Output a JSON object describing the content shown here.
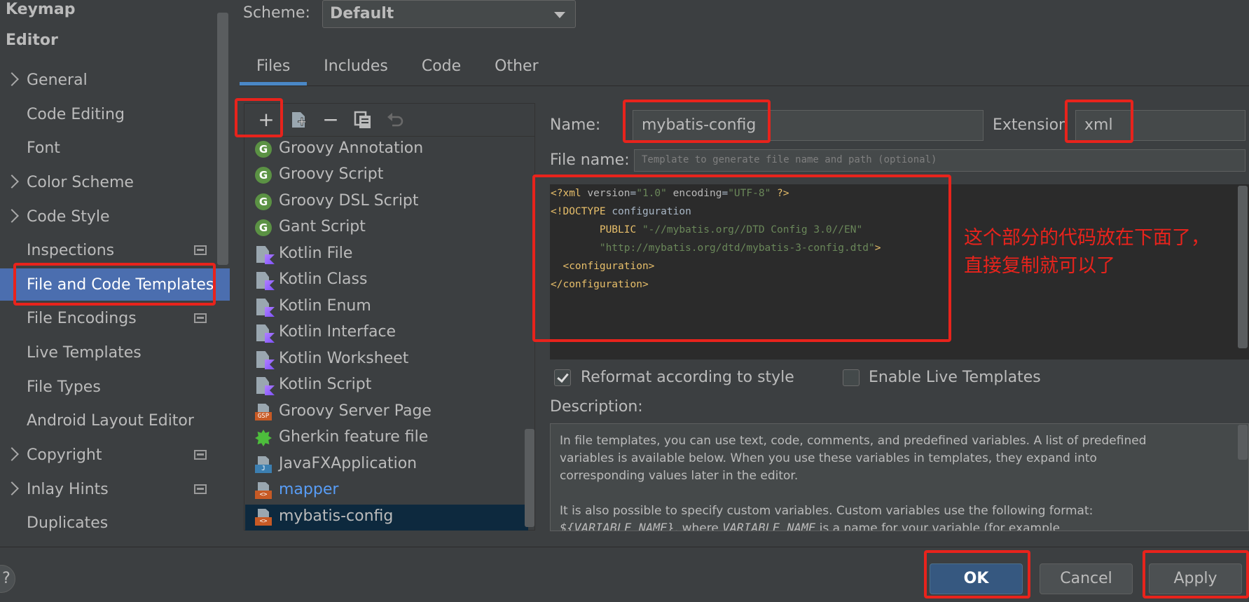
{
  "sidebar": {
    "items": [
      {
        "label": "Keymap",
        "kind": "header"
      },
      {
        "label": "Editor",
        "kind": "header"
      },
      {
        "label": "General",
        "expandable": true
      },
      {
        "label": "Code Editing"
      },
      {
        "label": "Font"
      },
      {
        "label": "Color Scheme",
        "expandable": true
      },
      {
        "label": "Code Style",
        "expandable": true
      },
      {
        "label": "Inspections",
        "project_icon": true
      },
      {
        "label": "File and Code Templates",
        "selected": true
      },
      {
        "label": "File Encodings",
        "project_icon": true
      },
      {
        "label": "Live Templates"
      },
      {
        "label": "File Types"
      },
      {
        "label": "Android Layout Editor"
      },
      {
        "label": "Copyright",
        "expandable": true,
        "project_icon": true
      },
      {
        "label": "Inlay Hints",
        "expandable": true,
        "project_icon": true
      },
      {
        "label": "Duplicates"
      }
    ]
  },
  "scheme": {
    "label": "Scheme:",
    "value": "Default"
  },
  "tabs": [
    {
      "label": "Files",
      "active": true
    },
    {
      "label": "Includes"
    },
    {
      "label": "Code"
    },
    {
      "label": "Other"
    }
  ],
  "toolbar": {
    "add": "+",
    "remove": "−"
  },
  "templates": [
    {
      "label": "Groovy Annotation",
      "icon": "groovy-icon"
    },
    {
      "label": "Groovy Script",
      "icon": "groovy-icon"
    },
    {
      "label": "Groovy DSL Script",
      "icon": "groovy-icon"
    },
    {
      "label": "Gant Script",
      "icon": "groovy-icon"
    },
    {
      "label": "Kotlin File",
      "icon": "kotlin-file-icon"
    },
    {
      "label": "Kotlin Class",
      "icon": "kotlin-file-icon"
    },
    {
      "label": "Kotlin Enum",
      "icon": "kotlin-file-icon"
    },
    {
      "label": "Kotlin Interface",
      "icon": "kotlin-file-icon"
    },
    {
      "label": "Kotlin Worksheet",
      "icon": "kotlin-file-icon"
    },
    {
      "label": "Kotlin Script",
      "icon": "kotlin-file-icon"
    },
    {
      "label": "Groovy Server Page",
      "icon": "gsp-file-icon",
      "tag": "GSP"
    },
    {
      "label": "Gherkin feature file",
      "icon": "gherkin-icon"
    },
    {
      "label": "JavaFXApplication",
      "icon": "java-file-icon",
      "tag": "J"
    },
    {
      "label": "mapper",
      "icon": "xml-file-icon",
      "tag": "<>",
      "link": true
    },
    {
      "label": "mybatis-config",
      "icon": "xml-file-icon",
      "tag": "<>",
      "selected": true
    }
  ],
  "form": {
    "name_label": "Name:",
    "name_value": "mybatis-config",
    "extension_label": "Extension",
    "extension_value": "xml",
    "filename_label": "File name:",
    "filename_placeholder": "Template to generate file name and path (optional)"
  },
  "code": {
    "l1_a": "<?xml ",
    "l1_b": "version",
    "l1_c": "=",
    "l1_d": "\"1.0\"",
    "l1_e": " encoding",
    "l1_f": "=",
    "l1_g": "\"UTF-8\"",
    "l1_h": " ?>",
    "l2_a": "<!DOCTYPE ",
    "l2_b": "configuration",
    "l3_a": "        PUBLIC ",
    "l3_b": "\"-//mybatis.org//DTD Config 3.0//EN\"",
    "l4_a": "        ",
    "l4_b": "\"http://mybatis.org/dtd/mybatis-3-config.dtd\"",
    "l4_c": ">",
    "l5": "  <configuration>",
    "l6": "</configuration>"
  },
  "annotation": {
    "line1": "这个部分的代码放在下面了，",
    "line2": "直接复制就可以了"
  },
  "options": {
    "reformat_label": "Reformat according to style",
    "reformat_checked": true,
    "live_templates_label": "Enable Live Templates",
    "live_templates_checked": false
  },
  "description": {
    "label": "Description:",
    "p1_l1": "In file templates, you can use text, code, comments, and predefined variables. A list of predefined",
    "p1_l2": "variables is available below. When you use these variables in templates, they expand into",
    "p1_l3": "corresponding values later in the editor.",
    "p2_l1": "It is also possible to specify custom variables. Custom variables use the following format:",
    "p2_l2_a": "${VARIABLE_NAME}",
    "p2_l2_b": ", where ",
    "p2_l2_c": "VARIABLE_NAME",
    "p2_l2_d": " is a name for your variable (for example"
  },
  "buttons": {
    "help": "?",
    "ok": "OK",
    "cancel": "Cancel",
    "apply": "Apply"
  },
  "colors": {
    "background": "#3c3f41",
    "selection": "#4b6eaf",
    "list_selection": "#0d293e",
    "editor_bg": "#2b2b2b",
    "annotation_red": "#e8231c",
    "primary_button": "#365880",
    "link": "#589df6"
  }
}
